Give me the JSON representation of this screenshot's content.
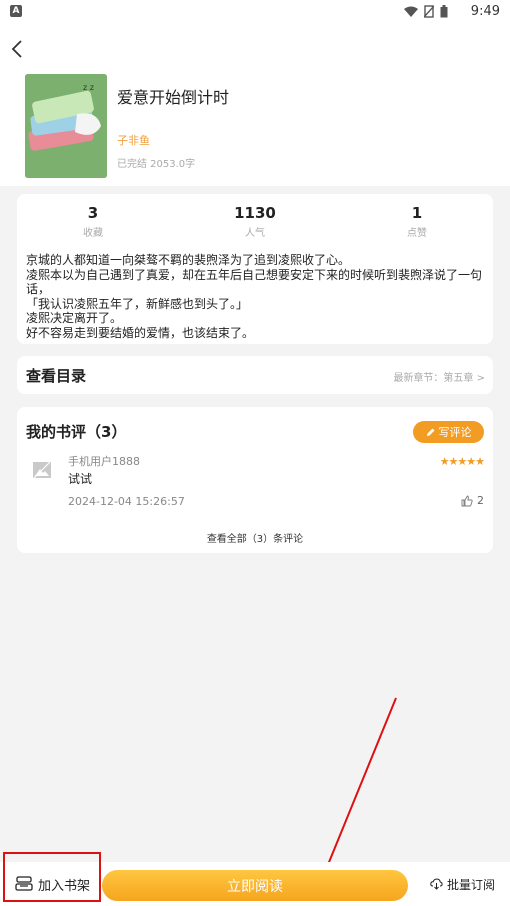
{
  "status_bar": {
    "time": "9:49",
    "app_badge": "A"
  },
  "book": {
    "title": "爱意开始倒计时",
    "author": "子非鱼",
    "status": "已完结 2053.0字"
  },
  "stats": [
    {
      "value": "3",
      "label": "收藏"
    },
    {
      "value": "1130",
      "label": "人气"
    },
    {
      "value": "1",
      "label": "点赞"
    }
  ],
  "description": [
    "京城的人都知道一向桀骜不羁的裴煦泽为了追到凌熙收了心。",
    "凌熙本以为自己遇到了真爱，却在五年后自己想要安定下来的时候听到裴煦泽说了一句话，",
    "「我认识凌熙五年了，新鲜感也到头了。」",
    "凌熙决定离开了。",
    "好不容易走到要结婚的爱情，也该结束了。"
  ],
  "toc": {
    "title": "查看目录",
    "latest": "最新章节：第五章 >"
  },
  "reviews": {
    "title": "我的书评（3）",
    "write_label": "写评论",
    "item": {
      "user": "手机用户1888",
      "stars": "★★★★★",
      "text": "试试",
      "time": "2024-12-04 15:26:57",
      "likes": "2"
    },
    "view_all": "查看全部（3）条评论"
  },
  "bottom": {
    "add_shelf": "加入书架",
    "read_now": "立即阅读",
    "batch_subscribe": "批量订阅"
  },
  "colors": {
    "accent": "#f39c23",
    "annotation": "#dd1111"
  }
}
